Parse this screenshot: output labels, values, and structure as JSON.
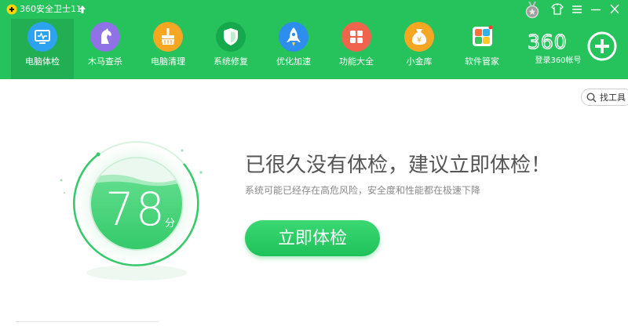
{
  "titlebar": {
    "app_title": "360安全卫士11"
  },
  "nav": {
    "items": [
      {
        "label": "电脑体检",
        "icon": "monitor-check-icon",
        "color": "#2da3f0",
        "active": true
      },
      {
        "label": "木马查杀",
        "icon": "horse-icon",
        "color": "#8f72e6",
        "active": false
      },
      {
        "label": "电脑清理",
        "icon": "broom-icon",
        "color": "#f5a623",
        "active": false
      },
      {
        "label": "系统修复",
        "icon": "shield-icon",
        "color": "#16a84c",
        "active": false
      },
      {
        "label": "优化加速",
        "icon": "rocket-icon",
        "color": "#2d8ef0",
        "active": false
      },
      {
        "label": "功能大全",
        "icon": "grid-icon",
        "color": "#f0644e",
        "active": false
      },
      {
        "label": "小金库",
        "icon": "money-bag-icon",
        "color": "#f5a623",
        "active": false
      },
      {
        "label": "软件管家",
        "icon": "software-manager-icon",
        "color": "#f5f5f5",
        "active": false
      }
    ]
  },
  "account": {
    "brand": "360",
    "login_label": "登录360帐号"
  },
  "tools": {
    "find_label": "找工具"
  },
  "main": {
    "score": "78",
    "score_unit": "分",
    "headline": "已很久没有体检，建议立即体检！",
    "subtext": "系统可能已经存在高危风险，安全度和性能都在极速下降",
    "scan_button_label": "立即体检"
  },
  "colors": {
    "brand_green": "#26c25c",
    "button_green": "#1fc15a",
    "headline_gray": "#555555"
  }
}
